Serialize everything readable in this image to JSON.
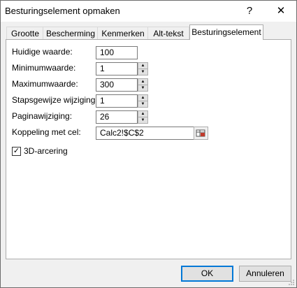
{
  "window": {
    "title": "Besturingselement opmaken",
    "help_label": "?",
    "close_label": "✕"
  },
  "tabs": [
    {
      "label": "Grootte"
    },
    {
      "label": "Bescherming"
    },
    {
      "label": "Kenmerken"
    },
    {
      "label": "Alt-tekst"
    },
    {
      "label": "Besturingselement",
      "active": true
    }
  ],
  "fields": {
    "current_value": {
      "label": "Huidige waarde:",
      "value": "100"
    },
    "minimum": {
      "label": "Minimumwaarde:",
      "value": "1"
    },
    "maximum": {
      "label": "Maximumwaarde:",
      "value": "300"
    },
    "increment": {
      "label": "Stapsgewijze wijziging:",
      "value": "1"
    },
    "page_change": {
      "label": "Paginawijziging:",
      "value": "26"
    },
    "cell_link": {
      "label": "Koppeling met cel:",
      "value": "Calc2!$C$2"
    }
  },
  "shading": {
    "label": "3D-arcering",
    "checked": true,
    "check_glyph": "✓"
  },
  "spinner": {
    "up_glyph": "▲",
    "down_glyph": "▼"
  },
  "buttons": {
    "ok": "OK",
    "cancel": "Annuleren"
  }
}
